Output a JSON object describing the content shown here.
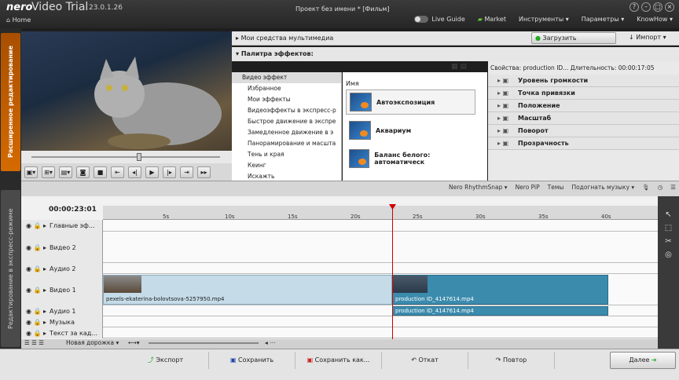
{
  "app": {
    "brand": "nero",
    "name": "Video Trial",
    "version": "23.0.1.26",
    "home": "Home",
    "doc_title": "Проект без имени * [Фильм]"
  },
  "menu": {
    "live_guide": "Live Guide",
    "market": "Market",
    "tools": "Инструменты ▾",
    "params": "Параметры ▾",
    "knowhow": "KnowHow ▾"
  },
  "sidebar": {
    "advanced": "Расширенное редактирование",
    "express": "Редактирование в экспресс-режиме"
  },
  "media": {
    "label": "Мои средства мультимедиа",
    "load": "Загрузить содержимое",
    "import": "↓ Импорт ▾"
  },
  "effects": {
    "label": "Палитра эффектов:",
    "categories": [
      "Видео эффект",
      "Избранное",
      "Мои эффекты",
      "Видеоэффекты в экспресс-р",
      "Быстрое движение в экспре",
      "Замедленное движение в э",
      "Панорамирование и масшта",
      "Тень и края",
      "Кеинг",
      "Искажть"
    ],
    "list_header": "Имя",
    "items": [
      "Автоэкспозиция",
      "Аквариум",
      "Баланс белого: автоматическ"
    ]
  },
  "properties": {
    "title": "Свойства: production ID... Длительность: 00:00:17:05",
    "items": [
      "Уровень громкости",
      "Точка привязки",
      "Положение",
      "Масштаб",
      "Поворот",
      "Прозрачность"
    ]
  },
  "timeline": {
    "tools": [
      "Nero RhythmSnap ▾",
      "Nero PiP",
      "Темы",
      "Подогнать музыку ▾"
    ],
    "timecode": "00:00:23:01",
    "ticks": [
      "5s",
      "10s",
      "15s",
      "20s",
      "25s",
      "30s",
      "35s",
      "40s"
    ],
    "tracks": [
      "Главные эф...",
      "Видео 2",
      "Аудио 2",
      "Видео 1",
      "Аудио 1",
      "Музыка",
      "Текст за кад..."
    ],
    "clip1": "pexels-ekaterina-bolovtsova-5257950.mp4",
    "clip2": "production ID_4147614.mp4",
    "clip2_audio": "production ID_4147614.mp4",
    "new_track": "Новая дорожка ▾"
  },
  "footer": {
    "export": "Экспорт",
    "save": "Сохранить",
    "save_as": "Сохранить как...",
    "undo": "Откат",
    "redo": "Повтор",
    "next": "Далее"
  }
}
